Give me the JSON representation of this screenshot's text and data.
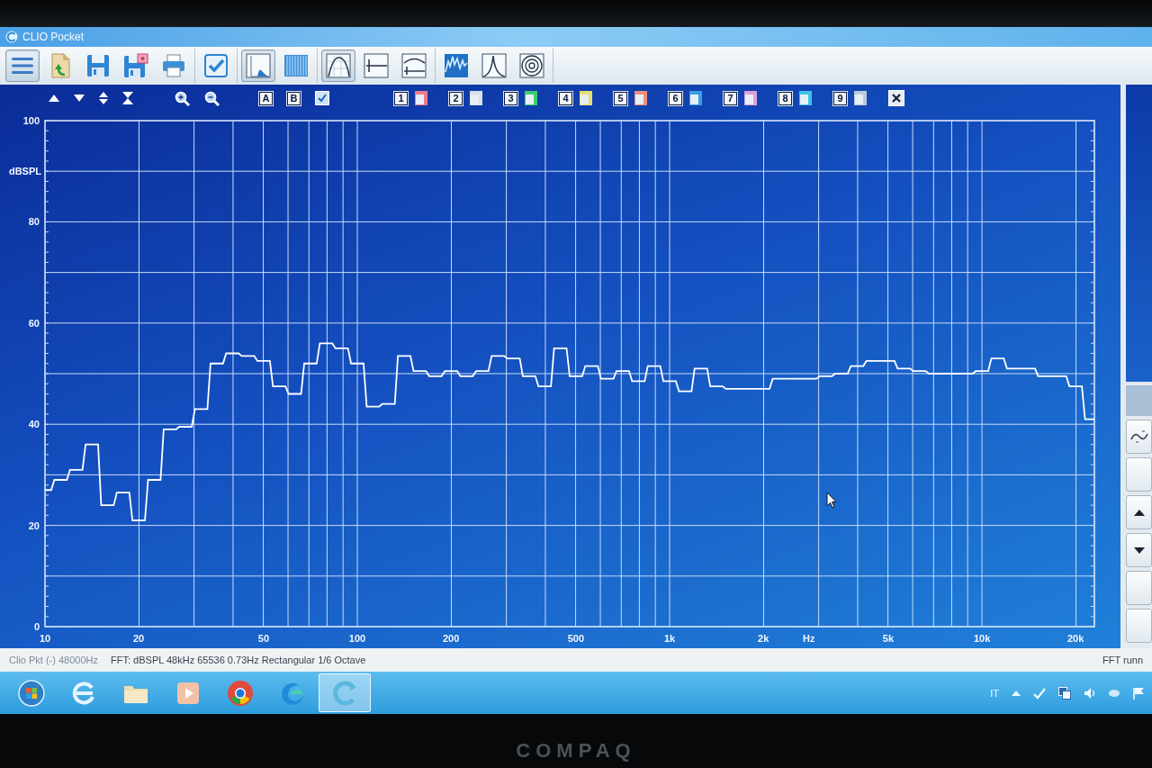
{
  "window": {
    "title": "CLIO Pocket"
  },
  "toolbar": {
    "groups": [
      [
        {
          "selected": true
        },
        {
          "selected": false
        },
        {
          "selected": false
        },
        {
          "selected": false
        },
        {
          "selected": false
        }
      ],
      [
        {
          "selected": false
        }
      ],
      [
        {
          "selected": true
        },
        {
          "selected": false
        }
      ],
      [
        {
          "selected": true
        },
        {
          "selected": false
        },
        {
          "selected": false
        }
      ],
      [
        {
          "selected": false
        },
        {
          "selected": false
        },
        {
          "selected": false
        }
      ]
    ]
  },
  "chart_tools": {
    "letters": [
      "A",
      "B"
    ],
    "overlays": [
      {
        "label": "1",
        "color": "#f07a8c"
      },
      {
        "label": "2",
        "color": "#d8e2ec"
      },
      {
        "label": "3",
        "color": "#3ccf6e"
      },
      {
        "label": "4",
        "color": "#e6e070"
      },
      {
        "label": "5",
        "color": "#f28c7c"
      },
      {
        "label": "6",
        "color": "#3a9ee6"
      },
      {
        "label": "7",
        "color": "#dca2dc"
      },
      {
        "label": "8",
        "color": "#3cc2ea"
      },
      {
        "label": "9",
        "color": "#b8cadc"
      }
    ]
  },
  "chart": {
    "chart_data": {
      "type": "line",
      "xlabel": "Hz",
      "ylabel": "dBSPL",
      "grid": true,
      "ylim": [
        0,
        100
      ],
      "yticks": [
        0,
        20,
        40,
        60,
        80,
        100
      ],
      "categories": [
        "10",
        null,
        null,
        null,
        null,
        null,
        null,
        null,
        null,
        null,
        null,
        null,
        null,
        null,
        null,
        null,
        null,
        null,
        null,
        null,
        null,
        null,
        null,
        null,
        null,
        null,
        null,
        null,
        null,
        null,
        "20",
        null,
        null,
        null,
        null,
        null,
        null,
        null,
        null,
        null,
        null,
        null,
        null,
        null,
        null,
        null,
        null,
        null,
        null,
        null,
        null,
        null,
        null,
        null,
        null,
        null,
        null,
        null,
        null,
        null,
        null,
        null,
        null,
        null,
        null,
        null,
        null,
        null,
        null,
        null,
        "50",
        null,
        null,
        null,
        null,
        null,
        null,
        null,
        null,
        null,
        null,
        null,
        null,
        null,
        null,
        null,
        null,
        null,
        null,
        null,
        null,
        null,
        null,
        null,
        null,
        null,
        null,
        null,
        null,
        null,
        "100",
        null,
        null,
        null,
        null,
        null,
        null,
        null,
        null,
        null,
        null,
        null,
        null,
        null,
        null,
        null,
        null,
        null,
        null,
        null,
        null,
        null,
        null,
        null,
        null,
        null,
        null,
        null,
        null,
        null,
        "200",
        null,
        null,
        null,
        null,
        null,
        null,
        null,
        null,
        null,
        null,
        null,
        null,
        null,
        null,
        null,
        null,
        null,
        null,
        null,
        null,
        null,
        null,
        null,
        null,
        null,
        null,
        null,
        null,
        null,
        null,
        null,
        null,
        null,
        null,
        null,
        null,
        null,
        null,
        null,
        "500",
        null,
        null,
        null,
        null,
        null,
        null,
        null,
        null,
        null,
        null,
        null,
        null,
        null,
        null,
        null,
        null,
        null,
        null,
        null,
        null,
        null,
        null,
        null,
        null,
        null,
        null,
        null,
        null,
        null,
        "1k",
        null,
        null,
        null,
        null,
        null,
        null,
        null,
        null,
        null,
        null,
        null,
        null,
        null,
        null,
        null,
        null,
        null,
        null,
        null,
        null,
        null,
        null,
        null,
        null,
        null,
        null,
        null,
        null,
        null,
        "2k",
        null,
        null,
        null,
        null,
        null,
        null,
        null,
        null,
        null,
        null,
        null,
        null,
        null,
        null,
        null,
        null,
        null,
        null,
        null,
        null,
        null,
        null,
        null,
        null,
        null,
        null,
        null,
        null,
        null,
        null,
        null,
        null,
        null,
        null,
        null,
        null,
        null,
        null,
        null,
        "5k",
        null,
        null,
        null,
        null,
        null,
        null,
        null,
        null,
        null,
        null,
        null,
        null,
        null,
        null,
        null,
        null,
        null,
        null,
        null,
        null,
        null,
        null,
        null,
        null,
        null,
        null,
        null,
        null,
        null,
        "10k",
        null,
        null,
        null,
        null,
        null,
        null,
        null,
        null,
        null,
        null,
        null,
        null,
        null,
        null,
        null,
        null,
        null,
        null,
        null,
        null,
        null,
        null,
        null,
        null,
        null,
        null,
        null,
        null,
        null,
        "20k",
        null,
        null,
        null,
        null,
        null,
        null
      ],
      "values": [
        27,
        27,
        27,
        29,
        29,
        29,
        29,
        29,
        31,
        31,
        31,
        31,
        31,
        36,
        36,
        36,
        36,
        36,
        24,
        24,
        24,
        24,
        24,
        26.5,
        26.5,
        26.5,
        26.5,
        26.5,
        21,
        21,
        21,
        21,
        21,
        29,
        29,
        29,
        29,
        29,
        39,
        39,
        39,
        39,
        39,
        39.5,
        39.5,
        39.5,
        39.5,
        39.5,
        43,
        43,
        43,
        43,
        43,
        52,
        52,
        52,
        52,
        52,
        54,
        54,
        54,
        54,
        54,
        53.5,
        53.5,
        53.5,
        53.5,
        53.5,
        52.5,
        52.5,
        52.5,
        52.5,
        52.5,
        47.5,
        47.5,
        47.5,
        47.5,
        47.5,
        46,
        46,
        46,
        46,
        46,
        52,
        52,
        52,
        52,
        52,
        56,
        56,
        56,
        56,
        56,
        55,
        55,
        55,
        55,
        55,
        52,
        52,
        52,
        52,
        52,
        43.5,
        43.5,
        43.5,
        43.5,
        43.5,
        44,
        44,
        44,
        44,
        44,
        53.5,
        53.5,
        53.5,
        53.5,
        53.5,
        50.5,
        50.5,
        50.5,
        50.5,
        50.5,
        49.5,
        49.5,
        49.5,
        49.5,
        49.5,
        50.5,
        50.5,
        50.5,
        50.5,
        50.5,
        49.5,
        49.5,
        49.5,
        49.5,
        49.5,
        50.5,
        50.5,
        50.5,
        50.5,
        50.5,
        53.5,
        53.5,
        53.5,
        53.5,
        53.5,
        53,
        53,
        53,
        53,
        53,
        49.5,
        49.5,
        49.5,
        49.5,
        49.5,
        47.5,
        47.5,
        47.5,
        47.5,
        47.5,
        55,
        55,
        55,
        55,
        55,
        49.5,
        49.5,
        49.5,
        49.5,
        49.5,
        51.5,
        51.5,
        51.5,
        51.5,
        51.5,
        49,
        49,
        49,
        49,
        49,
        50.5,
        50.5,
        50.5,
        50.5,
        50.5,
        48.5,
        48.5,
        48.5,
        48.5,
        48.5,
        51.5,
        51.5,
        51.5,
        51.5,
        51.5,
        48.5,
        48.5,
        48.5,
        48.5,
        48.5,
        46.5,
        46.5,
        46.5,
        46.5,
        46.5,
        51,
        51,
        51,
        51,
        51,
        47.5,
        47.5,
        47.5,
        47.5,
        47.5,
        47,
        47,
        47,
        47,
        47,
        47,
        47,
        47,
        47,
        47,
        47,
        47,
        47,
        47,
        47,
        49,
        49,
        49,
        49,
        49,
        49,
        49,
        49,
        49,
        49,
        49,
        49,
        49,
        49,
        49,
        49.5,
        49.5,
        49.5,
        49.5,
        49.5,
        50,
        50,
        50,
        50,
        50,
        51.5,
        51.5,
        51.5,
        51.5,
        51.5,
        52.5,
        52.5,
        52.5,
        52.5,
        52.5,
        52.5,
        52.5,
        52.5,
        52.5,
        52.5,
        51,
        51,
        51,
        51,
        51,
        50.5,
        50.5,
        50.5,
        50.5,
        50.5,
        50,
        50,
        50,
        50,
        50,
        50,
        50,
        50,
        50,
        50,
        50,
        50,
        50,
        50,
        50,
        50.5,
        50.5,
        50.5,
        50.5,
        50.5,
        53,
        53,
        53,
        53,
        53,
        51,
        51,
        51,
        51,
        51,
        51,
        51,
        51,
        51,
        51,
        49.5,
        49.5,
        49.5,
        49.5,
        49.5,
        49.5,
        49.5,
        49.5,
        49.5,
        49.5,
        47.5,
        47.5,
        47.5,
        47.5,
        47.5,
        41,
        41,
        41,
        41
      ]
    }
  },
  "status_bar": {
    "device": "Clio Pkt (-) 48000Hz",
    "settings": "FFT: dBSPL 48kHz 65536 0.73Hz Rectangular 1/6 Octave",
    "state": "FFT runn"
  },
  "taskbar": {
    "buttons": [
      {
        "selected": false
      },
      {
        "selected": false
      },
      {
        "selected": false
      },
      {
        "selected": false
      },
      {
        "selected": false
      },
      {
        "selected": false
      },
      {
        "selected": true
      }
    ],
    "language": "IT"
  },
  "monitor": {
    "logo": "COMPAQ"
  }
}
